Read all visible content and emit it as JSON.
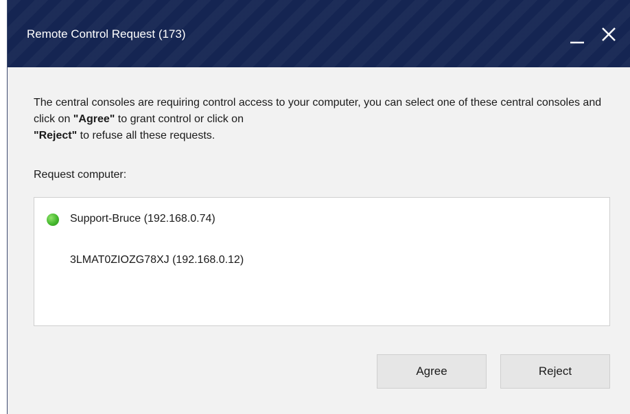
{
  "window": {
    "title": "Remote Control Request (173)"
  },
  "controls": {
    "minimize_icon": "minimize-icon",
    "close_icon": "close-icon"
  },
  "description": {
    "part1": "The central consoles are requiring control access to your computer, you can select one of these central consoles and click on ",
    "agree_bold": "\"Agree\"",
    "part2": " to grant control or click on ",
    "reject_bold": "\"Reject\"",
    "part3": " to refuse all these requests."
  },
  "request_label": "Request computer:",
  "requests": [
    {
      "name": "Support-Bruce (192.168.0.74)",
      "status": "online",
      "status_color": "#45b82e"
    },
    {
      "name": "3LMAT0ZIOZG78XJ (192.168.0.12)",
      "status": "none"
    }
  ],
  "buttons": {
    "agree": "Agree",
    "reject": "Reject"
  },
  "colors": {
    "titlebar": "#152552",
    "background": "#f2f2f2",
    "online": "#45b82e"
  }
}
